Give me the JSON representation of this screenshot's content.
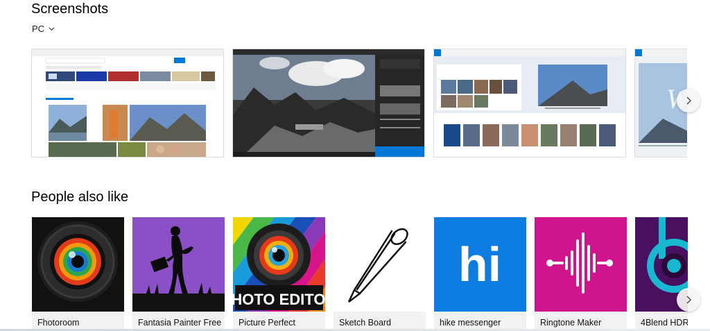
{
  "screenshots": {
    "title": "Screenshots",
    "platform": "PC",
    "platform_icon": "chevron-down-icon",
    "next_icon": "chevron-right-icon"
  },
  "people_also_like": {
    "title": "People also like",
    "next_icon": "chevron-right-icon",
    "apps": [
      {
        "name": "Fhotoroom"
      },
      {
        "name": "Fantasia Painter Free"
      },
      {
        "name": "Picture Perfect"
      },
      {
        "name": "Sketch Board"
      },
      {
        "name": "hike messenger"
      },
      {
        "name": "Ringtone Maker"
      },
      {
        "name": "4Blend HDR"
      }
    ]
  },
  "tile_text": {
    "photo_editor": "PHOTO EDITOR",
    "hike": "hi"
  },
  "colors": {
    "accent": "#0078d7",
    "hike_blue": "#0d7ce0",
    "ringtone_pink": "#d0148e",
    "fantasia_purple": "#8b50c8",
    "blend_purple": "#4a1060"
  }
}
